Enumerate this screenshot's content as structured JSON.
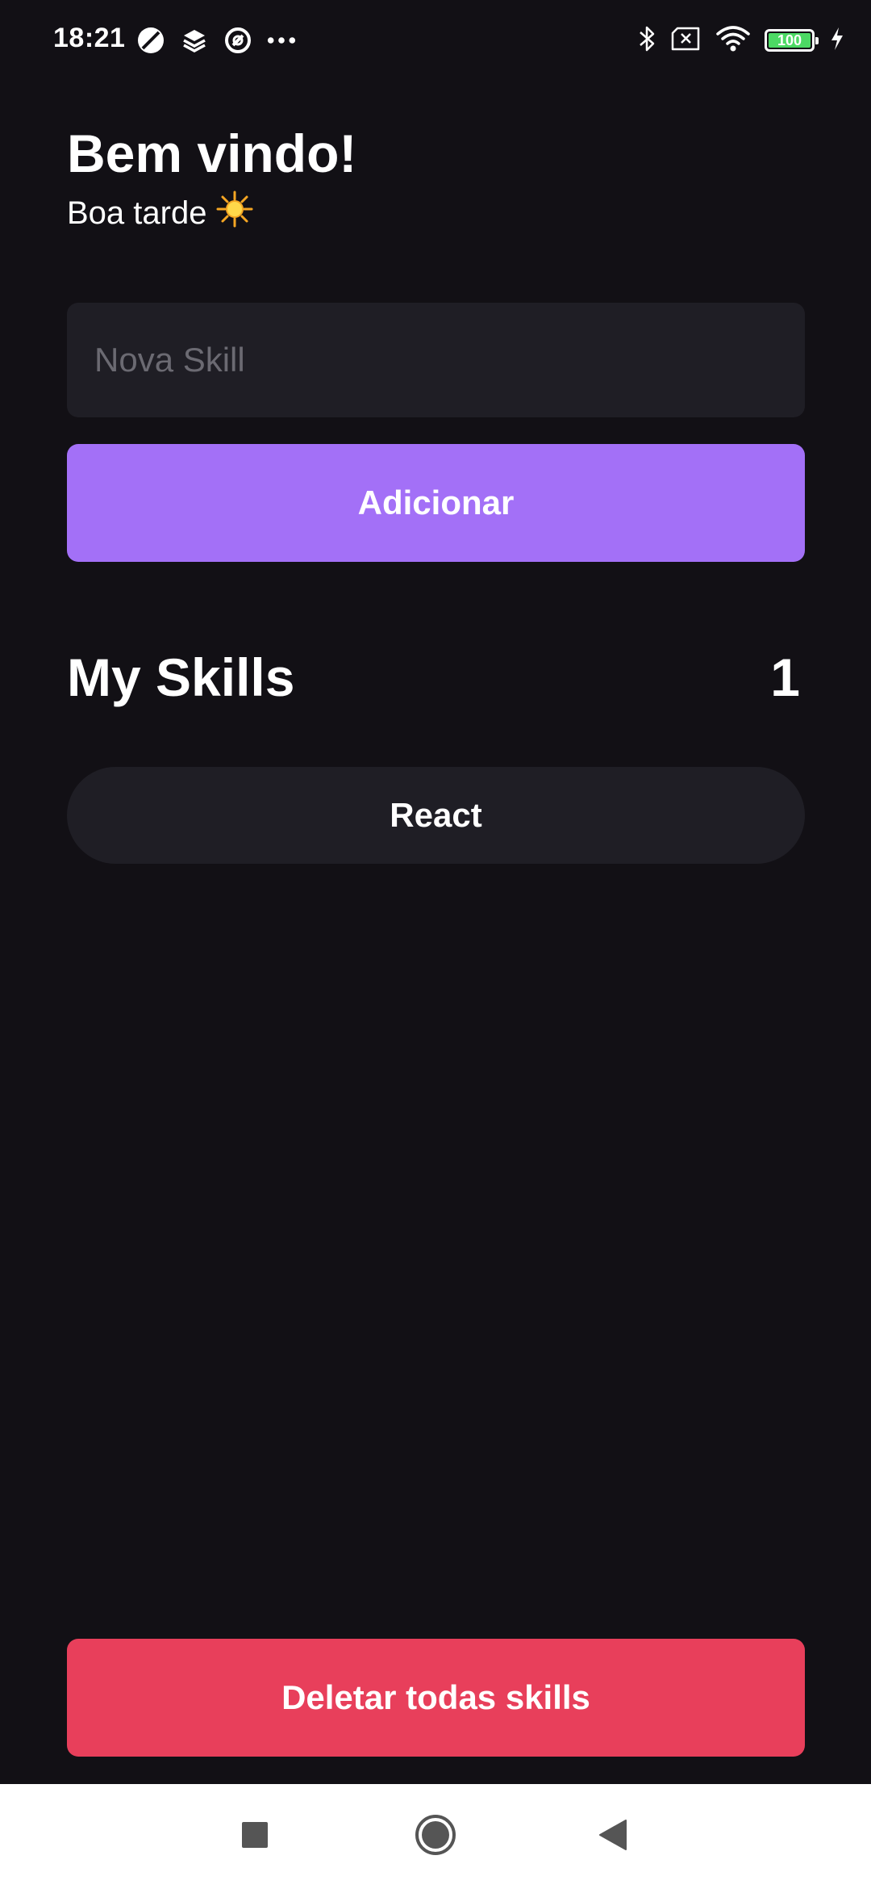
{
  "status_bar": {
    "time": "18:21",
    "left_icons": [
      "compass-icon",
      "layers-icon",
      "at-sign-icon",
      "more-dots-icon"
    ],
    "right_icons": [
      "bluetooth-icon",
      "no-sim-icon",
      "wifi-icon",
      "battery-icon",
      "charging-bolt-icon"
    ],
    "battery_level": "100",
    "battery_color": "#4cd964"
  },
  "header": {
    "title": "Bem vindo!",
    "subtitle": "Boa tarde",
    "subtitle_icon": "sun-icon"
  },
  "form": {
    "input_placeholder": "Nova Skill",
    "input_value": "",
    "add_button_label": "Adicionar"
  },
  "skills": {
    "title": "My Skills",
    "count": "1",
    "items": [
      {
        "label": "React"
      }
    ]
  },
  "delete_button_label": "Deletar todas skills",
  "nav_bar": {
    "buttons": [
      "recents-square-icon",
      "home-circle-icon",
      "back-triangle-icon"
    ]
  },
  "colors": {
    "background": "#121015",
    "surface": "#1f1e25",
    "accent": "#a370f7",
    "danger": "#e83f5b",
    "text": "#ffffff",
    "placeholder": "#6b6a72"
  }
}
